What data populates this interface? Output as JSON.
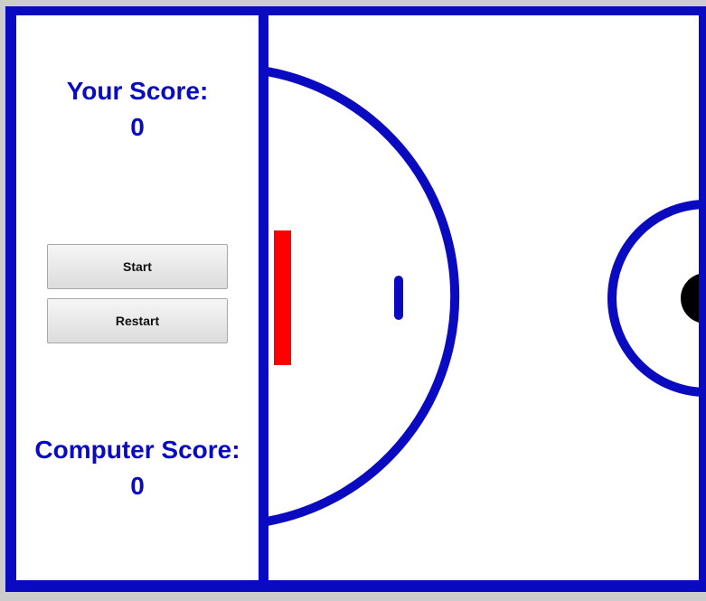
{
  "sidebar": {
    "player_score_label": "Your Score:",
    "player_score_value": "0",
    "computer_score_label": "Computer Score:",
    "computer_score_value": "0",
    "start_button_label": "Start",
    "restart_button_label": "Restart"
  },
  "colors": {
    "border": "#0a0ac0",
    "court_background": "#ffffff",
    "player_paddle": "#ff0000",
    "computer_paddle": "#0a0ac0",
    "puck": "#000000",
    "score_text": "#0a0ac0"
  }
}
